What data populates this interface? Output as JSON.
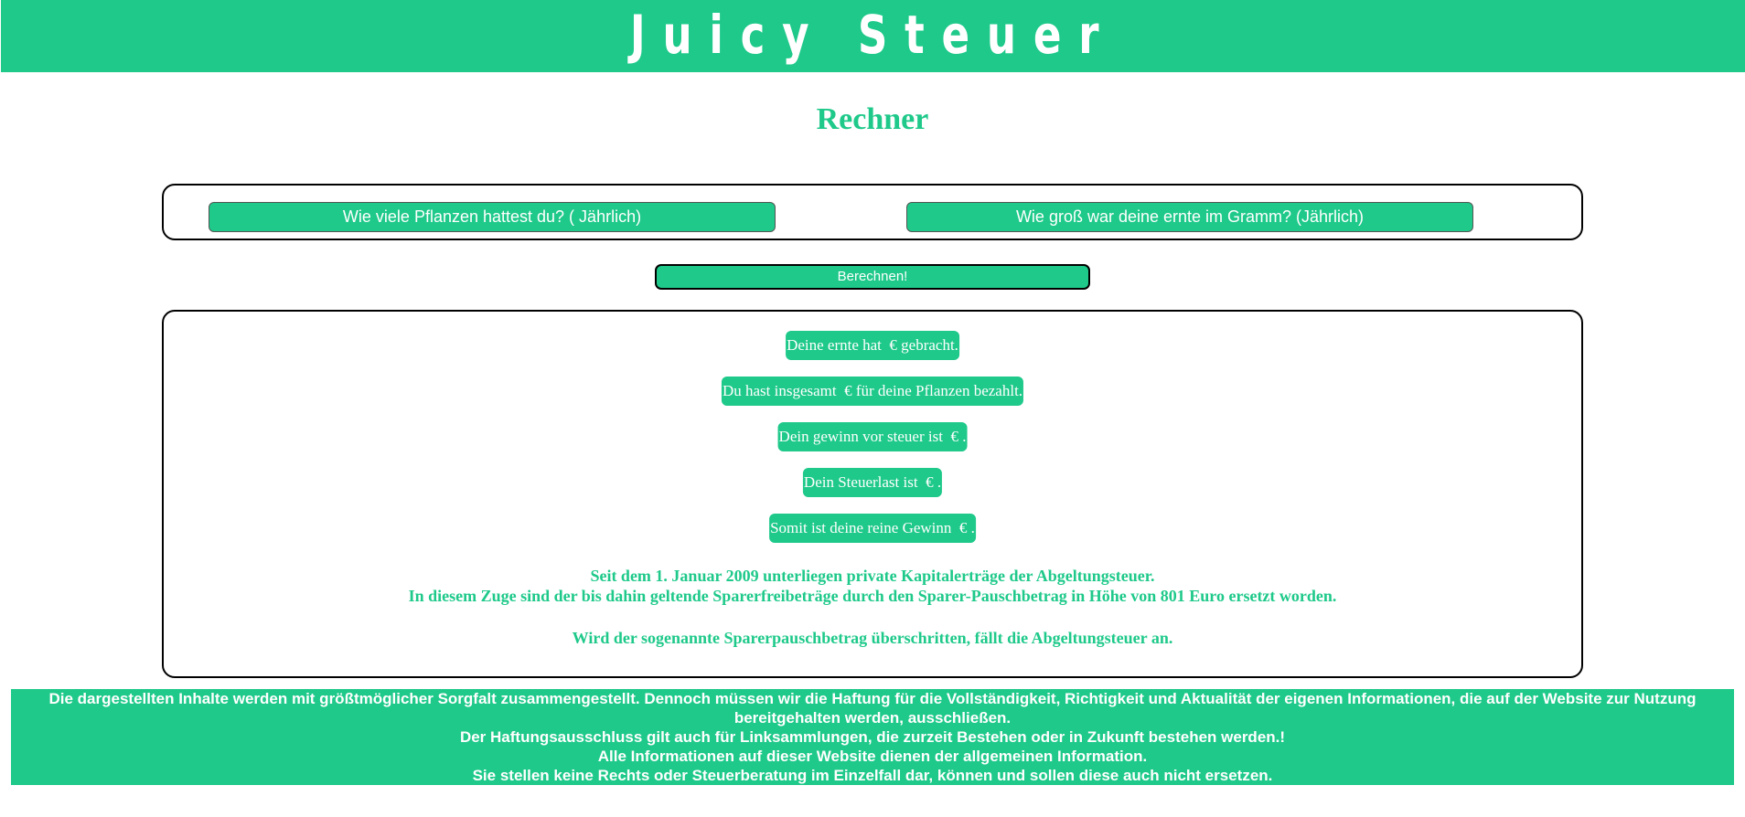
{
  "header": {
    "title": "Juicy Steuer"
  },
  "main": {
    "heading": "Rechner",
    "inputs": {
      "plants_placeholder": "Wie viele Pflanzen hattest du? ( Jährlich)",
      "harvest_placeholder": "Wie groß war deine ernte im Gramm? (Jährlich)"
    },
    "calculate_label": "Berechnen!",
    "results": [
      "Deine ernte hat  € gebracht.",
      "Du hast insgesamt  € für deine Pflanzen bezahlt.",
      "Dein gewinn vor steuer ist  € .",
      "Dein Steuerlast ist  € .",
      "Somit ist deine reine Gewinn  € ."
    ],
    "info": {
      "line1": "Seit dem 1. Januar 2009 unterliegen private Kapitalerträge der Abgeltungsteuer.",
      "line2": "In diesem Zuge sind der bis dahin geltende Sparerfreibeträge durch den Sparer-Pauschbetrag in Höhe von 801 Euro ersetzt worden.",
      "line3": "Wird der sogenannte Sparerpauschbetrag überschritten, fällt die Abgeltungsteuer an."
    }
  },
  "footer": {
    "lines": [
      "Die dargestellten Inhalte werden mit größtmöglicher Sorgfalt zusammengestellt. Dennoch müssen wir die Haftung für die Vollständigkeit, Richtigkeit und Aktualität der eigenen Informationen, die auf der Website zur Nutzung bereitgehalten werden, ausschließen.",
      "Der Haftungsausschluss gilt auch für Linksammlungen, die zurzeit Bestehen oder in Zukunft bestehen werden.!",
      "Alle Informationen auf dieser Website dienen der allgemeinen Information.",
      "Sie stellen keine Rechts oder Steuerberatung im Einzelfall dar, können und sollen diese auch nicht ersetzen."
    ]
  },
  "colors": {
    "brand_green": "#1ec98a",
    "text_white": "#ffffff",
    "border_black": "#000000"
  }
}
